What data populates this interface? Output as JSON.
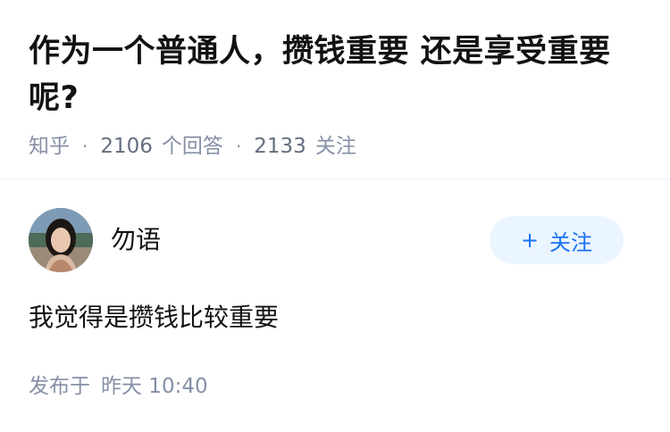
{
  "question": {
    "title": "作为一个普通人，攒钱重要 还是享受重要呢?",
    "source": "知乎",
    "separator": "·",
    "answer_count": "2106",
    "answer_label": "个回答",
    "follower_count": "2133",
    "follower_label": "关注"
  },
  "answer": {
    "author": {
      "name": "勿语",
      "avatar_icon": "user-photo-avatar"
    },
    "follow_button": {
      "plus": "+",
      "label": "关注"
    },
    "content": "我觉得是攒钱比较重要",
    "published_label": "发布于",
    "published_time": "昨天 10:40"
  },
  "colors": {
    "title": "#121212",
    "meta": "#8590a6",
    "follow_bg": "#ebf5ff",
    "follow_text": "#1772f6",
    "divider": "#f0f1f4"
  }
}
